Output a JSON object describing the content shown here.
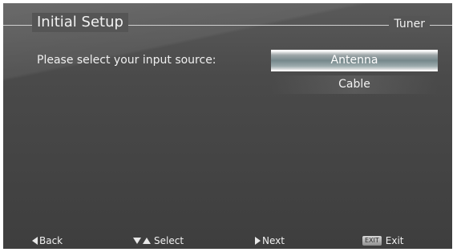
{
  "header": {
    "title": "Initial Setup",
    "section": "Tuner"
  },
  "main": {
    "prompt": "Please select your input source:",
    "options": [
      {
        "label": "Antenna",
        "selected": true
      },
      {
        "label": "Cable",
        "selected": false
      }
    ]
  },
  "footer": {
    "back_label": "Back",
    "select_label": "Select",
    "next_label": "Next",
    "exit_key": "EXIT",
    "exit_label": "Exit"
  },
  "colors": {
    "background": "#4a4a4a",
    "text": "#f0f0f0",
    "highlight": "#75888b"
  },
  "icons": {
    "back": "left-arrow-icon",
    "select": "down-up-arrows-icon",
    "next": "right-arrow-icon",
    "exit": "exit-key-icon"
  }
}
